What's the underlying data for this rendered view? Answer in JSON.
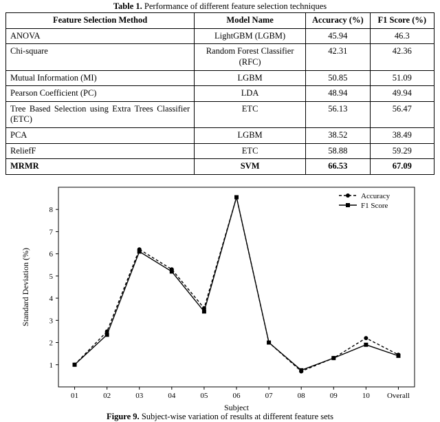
{
  "table": {
    "title_prefix": "Table 1.",
    "title_rest": " Performance of different feature selection techniques",
    "headers": [
      "Feature Selection Method",
      "Model Name",
      "Accuracy (%)",
      "F1 Score (%)"
    ],
    "rows": [
      {
        "method": "ANOVA",
        "model": "LightGBM (LGBM)",
        "acc": "45.94",
        "f1": "46.3",
        "bold": false
      },
      {
        "method": "Chi-square",
        "model": "Random Forest Classifier (RFC)",
        "acc": "42.31",
        "f1": "42.36",
        "bold": false
      },
      {
        "method": "Mutual Information (MI)",
        "model": "LGBM",
        "acc": "50.85",
        "f1": "51.09",
        "bold": false
      },
      {
        "method": "Pearson Coefficient (PC)",
        "model": "LDA",
        "acc": "48.94",
        "f1": "49.94",
        "bold": false
      },
      {
        "method": "Tree Based Selection using Extra Trees Classifier (ETC)",
        "model": "ETC",
        "acc": "56.13",
        "f1": "56.47",
        "bold": false
      },
      {
        "method": "PCA",
        "model": "LGBM",
        "acc": "38.52",
        "f1": "38.49",
        "bold": false
      },
      {
        "method": "ReliefF",
        "model": "ETC",
        "acc": "58.88",
        "f1": "59.29",
        "bold": false
      },
      {
        "method": "MRMR",
        "model": "SVM",
        "acc": "66.53",
        "f1": "67.09",
        "bold": true
      }
    ]
  },
  "figure": {
    "caption_prefix": "Figure 9.",
    "caption_rest": " Subject-wise variation of results at different feature sets",
    "legend": [
      "Accuracy",
      "F1 Score"
    ]
  },
  "chart_data": {
    "type": "line",
    "title": "",
    "xlabel": "Subject",
    "ylabel": "Standard Deviation (%)",
    "ylim": [
      0,
      9
    ],
    "yticks": [
      1,
      2,
      3,
      4,
      5,
      6,
      7,
      8
    ],
    "categories": [
      "01",
      "02",
      "03",
      "04",
      "05",
      "06",
      "07",
      "08",
      "09",
      "10",
      "Overall"
    ],
    "series": [
      {
        "name": "Accuracy",
        "marker": "circle",
        "dash": "4 3",
        "values": [
          1.0,
          2.5,
          6.2,
          5.3,
          3.55,
          8.55,
          2.0,
          0.7,
          1.3,
          2.2,
          1.45
        ]
      },
      {
        "name": "F1 Score",
        "marker": "square",
        "dash": "none",
        "values": [
          1.0,
          2.35,
          6.1,
          5.2,
          3.4,
          8.55,
          2.0,
          0.75,
          1.3,
          1.9,
          1.4
        ]
      }
    ]
  }
}
